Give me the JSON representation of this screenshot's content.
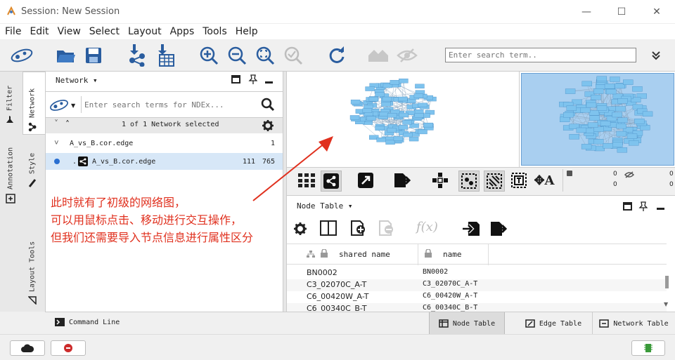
{
  "window": {
    "title": "Session: New Session"
  },
  "menu": [
    "File",
    "Edit",
    "View",
    "Select",
    "Layout",
    "Apps",
    "Tools",
    "Help"
  ],
  "toolbar": {
    "search_placeholder": "Enter search term..",
    "icons": [
      "cytoscape-logo-icon",
      "open-folder-icon",
      "save-icon",
      "import-network-icon",
      "import-table-icon",
      "zoom-in-icon",
      "zoom-out-icon",
      "zoom-selected-icon",
      "zoom-fit-icon",
      "refresh-layout-icon",
      "home-icon",
      "hide-icon",
      "more-icon"
    ]
  },
  "leftrail": {
    "tabs": [
      "Network",
      "Style",
      "Filter",
      "Annotation",
      "Layout Tools"
    ]
  },
  "network_panel": {
    "header": "Network",
    "ndex_placeholder": "Enter search terms for NDEx...",
    "status": "1 of 1 Network selected",
    "collection": {
      "name": "A_vs_B.cor.edge",
      "count": "1"
    },
    "network": {
      "name": "A_vs_B.cor.edge",
      "nodes": "111",
      "edges": "765"
    }
  },
  "view_toolbar": {
    "counts": {
      "selected_nodes": "0",
      "selected_edges": "0",
      "hidden_nodes": "0",
      "hidden_edges": "0"
    }
  },
  "annotation": {
    "lines": [
      "此时就有了初级的网络图，",
      "可以用鼠标点击、移动进行交互操作，",
      "但我们还需要导入节点信息进行属性区分"
    ]
  },
  "table_panel": {
    "header": "Node Table",
    "func_label": "f(x)",
    "columns": [
      "shared name",
      "name"
    ],
    "rows": [
      {
        "shared": "BN0002",
        "name": "BN0002"
      },
      {
        "shared": "C3_02070C_A-T",
        "name": "C3_02070C_A-T"
      },
      {
        "shared": "C6_00420W_A-T",
        "name": "C6_00420W_A-T"
      },
      {
        "shared": "C6_00340C_B-T",
        "name": "C6_00340C_B-T"
      }
    ]
  },
  "bottom_tabs": {
    "command": "Command Line",
    "node": "Node Table",
    "edge": "Edge Table",
    "network": "Network Table"
  },
  "colors": {
    "accent": "#5aa9e6",
    "annotation": "#e0301e",
    "node": "#7ec3ee",
    "overview_bg": "#a9cff0"
  }
}
